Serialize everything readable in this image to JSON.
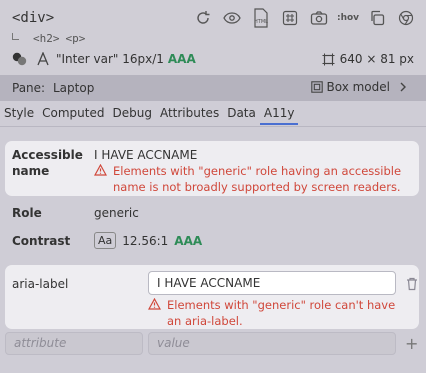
{
  "header": {
    "element_tag": "<div>",
    "breadcrumb": [
      "<h2>",
      "<p>"
    ],
    "font_desc": "\"Inter var\" 16px/1",
    "font_rating": "AAA",
    "dimensions": "640 × 81 px",
    "toolbar_icons": [
      "reload-icon",
      "eye-icon",
      "html-icon",
      "grid-icon",
      "camera-icon",
      "hov-icon",
      "copy-icon",
      "chrome-icon"
    ],
    "hov_label": ":hov",
    "html_label": "HTML"
  },
  "pane": {
    "label": "Pane:",
    "value": "Laptop",
    "box_model": "Box model"
  },
  "tabs": [
    {
      "label": "Style"
    },
    {
      "label": "Computed"
    },
    {
      "label": "Debug"
    },
    {
      "label": "Attributes"
    },
    {
      "label": "Data"
    },
    {
      "label": "A11y",
      "active": true
    }
  ],
  "a11y": {
    "accessible_name_label_1": "Accessible",
    "accessible_name_label_2": "name",
    "accessible_name_value": "I HAVE ACCNAME",
    "accessible_name_warning_1": "Elements with \"generic\" role having an accessible",
    "accessible_name_warning_2": "name is not broadly supported by screen readers.",
    "role_label": "Role",
    "role_value": "generic",
    "contrast_label": "Contrast",
    "contrast_sample": "Aa",
    "contrast_ratio": "12.56:1",
    "contrast_rating": "AAA",
    "aria_label_name": "aria-label",
    "aria_label_value": "I HAVE ACCNAME",
    "aria_label_warning_1": "Elements with \"generic\" role can't have",
    "aria_label_warning_2": "an aria-label.",
    "new_attribute_placeholder": "attribute",
    "new_value_placeholder": "value"
  },
  "colors": {
    "warning": "#d0473a",
    "pass": "#2e8b57",
    "active_tab": "#4a6fd1"
  }
}
